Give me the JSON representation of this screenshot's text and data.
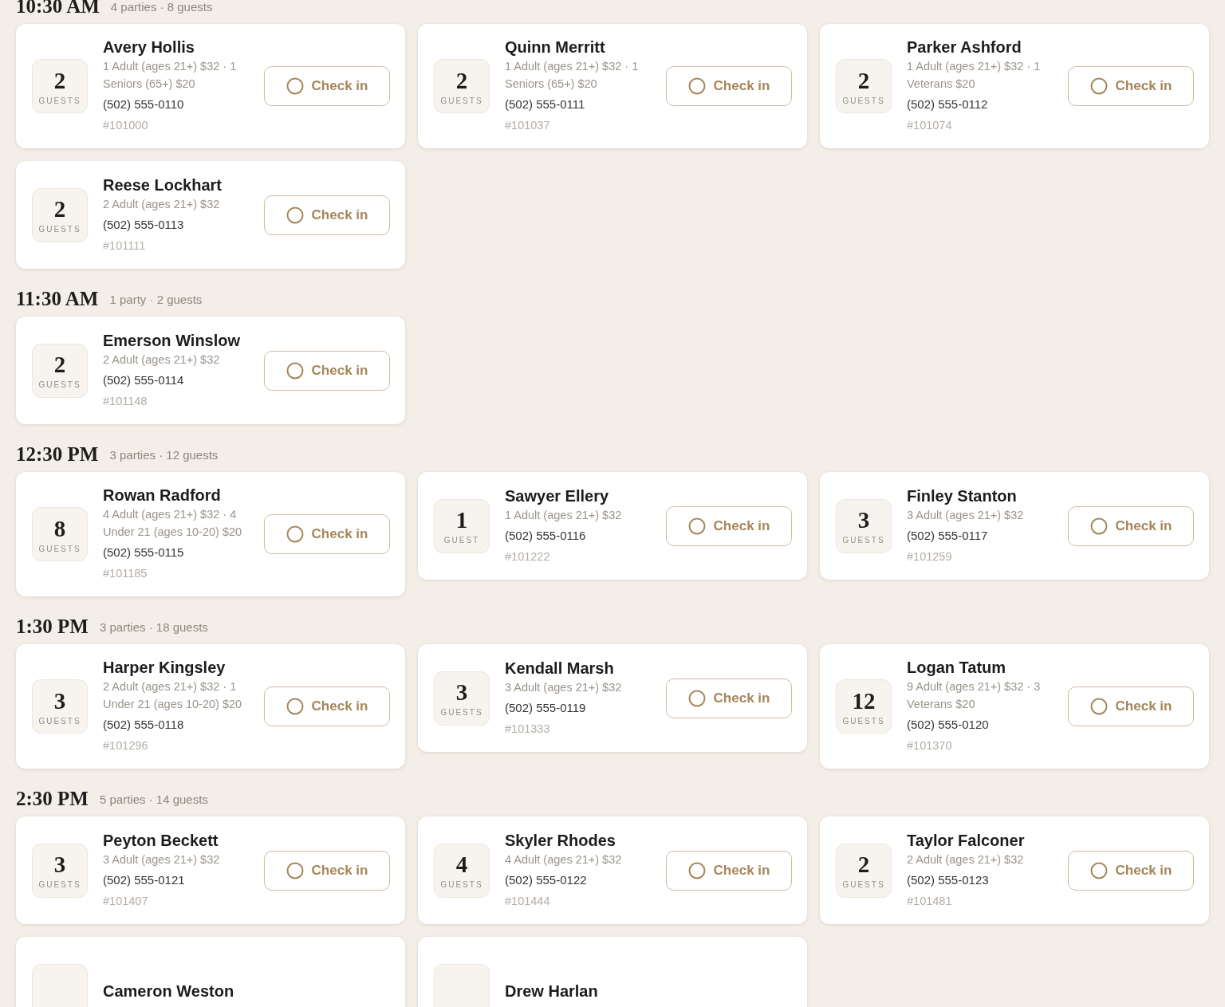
{
  "sections": [
    {
      "time": "10:30 AM",
      "summary": "4 parties · 8 guests",
      "parties": [
        {
          "guests": "2",
          "guest_label": "GUESTS",
          "name": "Avery Hollis",
          "details": "1 Adult (ages 21+) $32 · 1 Seniors (65+) $20",
          "phone": "(502) 555-0110",
          "ref": "#101000",
          "checked_in": false,
          "action": "Check in"
        },
        {
          "guests": "2",
          "guest_label": "GUESTS",
          "name": "Quinn Merritt",
          "details": "1 Adult (ages 21+) $32 · 1 Seniors (65+) $20",
          "phone": "(502) 555-0111",
          "ref": "#101037",
          "checked_in": false,
          "action": "Check in"
        },
        {
          "guests": "2",
          "guest_label": "GUESTS",
          "name": "Parker Ashford",
          "details": "1 Adult (ages 21+) $32 · 1 Veterans $20",
          "phone": "(502) 555-0112",
          "ref": "#101074",
          "checked_in": false,
          "action": "Check in"
        },
        {
          "guests": "2",
          "guest_label": "GUESTS",
          "name": "Reese Lockhart",
          "details": "2 Adult (ages 21+) $32",
          "phone": "(502) 555-0113",
          "ref": "#101111",
          "checked_in": false,
          "action": "Check in"
        }
      ]
    },
    {
      "time": "11:30 AM",
      "summary": "1 party · 2 guests",
      "parties": [
        {
          "guests": "2",
          "guest_label": "GUESTS",
          "name": "Emerson Winslow",
          "details": "2 Adult (ages 21+) $32",
          "phone": "(502) 555-0114",
          "ref": "#101148",
          "checked_in": false,
          "action": "Check in"
        }
      ]
    },
    {
      "time": "12:30 PM",
      "summary": "3 parties · 12 guests",
      "parties": [
        {
          "guests": "8",
          "guest_label": "GUESTS",
          "name": "Rowan Radford",
          "details": "4 Adult (ages 21+) $32 · 4 Under 21 (ages 10-20) $20",
          "phone": "(502) 555-0115",
          "ref": "#101185",
          "checked_in": false,
          "action": "Check in"
        },
        {
          "guests": "1",
          "guest_label": "GUEST",
          "name": "Sawyer Ellery",
          "details": "1 Adult (ages 21+) $32",
          "phone": "(502) 555-0116",
          "ref": "#101222",
          "checked_in": false,
          "action": "Check in"
        },
        {
          "guests": "3",
          "guest_label": "GUESTS",
          "name": "Finley Stanton",
          "details": "3 Adult (ages 21+) $32",
          "phone": "(502) 555-0117",
          "ref": "#101259",
          "checked_in": false,
          "action": "Check in"
        }
      ]
    },
    {
      "time": "1:30 PM",
      "summary": "3 parties · 18 guests",
      "parties": [
        {
          "guests": "3",
          "guest_label": "GUESTS",
          "name": "Harper Kingsley",
          "details": "2 Adult (ages 21+) $32 · 1 Under 21 (ages 10-20) $20",
          "phone": "(502) 555-0118",
          "ref": "#101296",
          "checked_in": false,
          "action": "Check in"
        },
        {
          "guests": "3",
          "guest_label": "GUESTS",
          "name": "Kendall Marsh",
          "details": "3 Adult (ages 21+) $32",
          "phone": "(502) 555-0119",
          "ref": "#101333",
          "checked_in": false,
          "action": "Check in"
        },
        {
          "guests": "12",
          "guest_label": "GUESTS",
          "name": "Logan Tatum",
          "details": "9 Adult (ages 21+) $32 · 3 Veterans $20",
          "phone": "(502) 555-0120",
          "ref": "#101370",
          "checked_in": false,
          "action": "Check in"
        }
      ]
    },
    {
      "time": "2:30 PM",
      "summary": "5 parties · 14 guests",
      "parties": [
        {
          "guests": "3",
          "guest_label": "GUESTS",
          "name": "Peyton Beckett",
          "details": "3 Adult (ages 21+) $32",
          "phone": "(502) 555-0121",
          "ref": "#101407",
          "checked_in": false,
          "action": "Check in"
        },
        {
          "guests": "4",
          "guest_label": "GUESTS",
          "name": "Skyler Rhodes",
          "details": "4 Adult (ages 21+) $32",
          "phone": "(502) 555-0122",
          "ref": "#101444",
          "checked_in": false,
          "action": "Check in"
        },
        {
          "guests": "2",
          "guest_label": "GUESTS",
          "name": "Taylor Falconer",
          "details": "2 Adult (ages 21+) $32",
          "phone": "(502) 555-0123",
          "ref": "#101481",
          "checked_in": false,
          "action": "Check in"
        },
        {
          "name": "Cameron Weston"
        },
        {
          "name": "Drew Harlan"
        }
      ]
    }
  ]
}
